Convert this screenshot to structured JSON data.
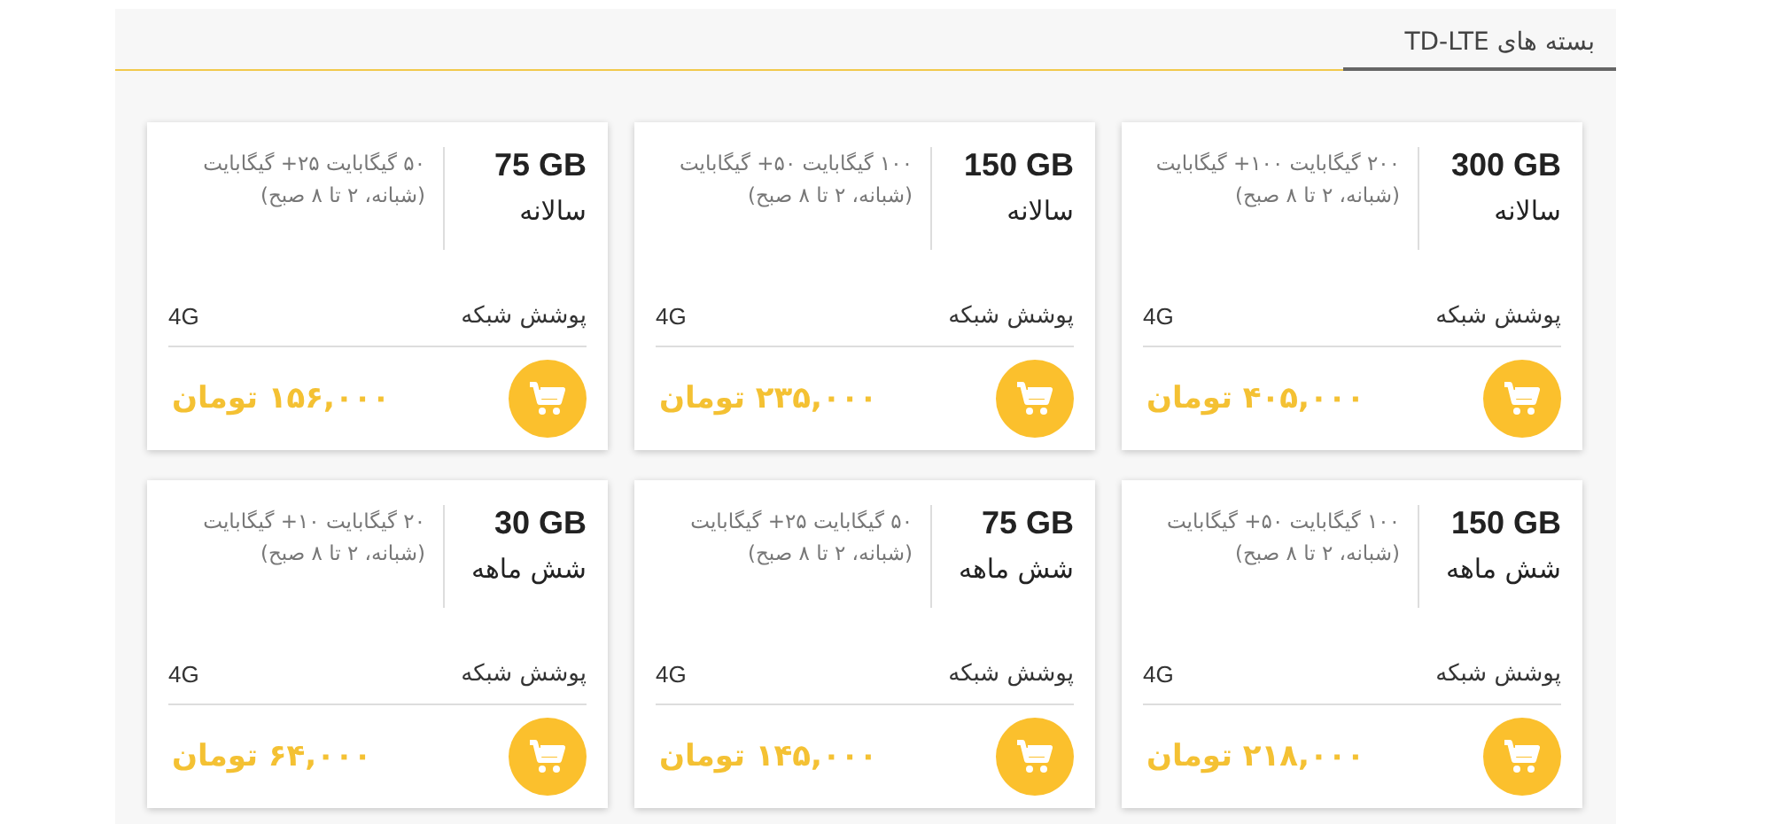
{
  "header": {
    "title": "بسته های TD-LTE"
  },
  "packages": [
    {
      "volume": "300 GB",
      "period": "سالانه",
      "description": "۲۰۰ گیگابایت ۱۰۰+ گیگابایت (شبانه، ۲ تا ۸ صبح)",
      "coverage_label": "پوشش شبکه",
      "coverage": "4G",
      "price": "۴۰۵,۰۰۰ تومان"
    },
    {
      "volume": "150 GB",
      "period": "سالانه",
      "description": "۱۰۰ گیگابایت ۵۰+ گیگابایت (شبانه، ۲ تا ۸ صبح)",
      "coverage_label": "پوشش شبکه",
      "coverage": "4G",
      "price": "۲۳۵,۰۰۰ تومان"
    },
    {
      "volume": "75 GB",
      "period": "سالانه",
      "description": "۵۰ گیگابایت ۲۵+ گیگابایت (شبانه، ۲ تا ۸ صبح)",
      "coverage_label": "پوشش شبکه",
      "coverage": "4G",
      "price": "۱۵۶,۰۰۰ تومان"
    },
    {
      "volume": "150 GB",
      "period": "شش ماهه",
      "description": "۱۰۰ گیگابایت ۵۰+ گیگابایت (شبانه، ۲ تا ۸ صبح)",
      "coverage_label": "پوشش شبکه",
      "coverage": "4G",
      "price": "۲۱۸,۰۰۰ تومان"
    },
    {
      "volume": "75 GB",
      "period": "شش ماهه",
      "description": "۵۰ گیگابایت ۲۵+ گیگابایت (شبانه، ۲ تا ۸ صبح)",
      "coverage_label": "پوشش شبکه",
      "coverage": "4G",
      "price": "۱۴۵,۰۰۰ تومان"
    },
    {
      "volume": "30 GB",
      "period": "شش ماهه",
      "description": "۲۰ گیگابایت ۱۰+ گیگابایت (شبانه، ۲ تا ۸ صبح)",
      "coverage_label": "پوشش شبکه",
      "coverage": "4G",
      "price": "۶۴,۰۰۰ تومان"
    }
  ]
}
